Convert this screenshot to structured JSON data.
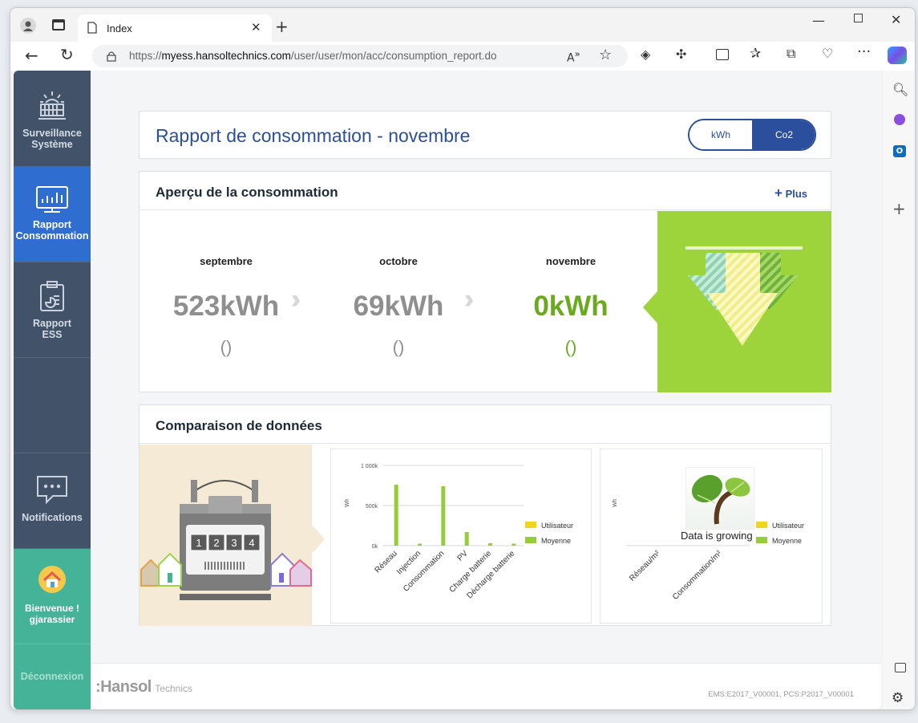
{
  "browser": {
    "tab_title": "Index",
    "url_prefix": "https://",
    "url_domain": "myess.hansoltechnics.com",
    "url_path": "/user/user/mon/acc/consumption_report.do"
  },
  "sidebar": {
    "items": [
      {
        "label1": "Surveillance",
        "label2": "Système"
      },
      {
        "label1": "Rapport",
        "label2": "Consommation"
      },
      {
        "label1": "Rapport",
        "label2": "ESS"
      },
      {
        "label1": "Notifications"
      },
      {
        "label1": "Bienvenue !",
        "label2": "gjarassier"
      },
      {
        "label1": "Déconnexion"
      }
    ]
  },
  "header": {
    "title": "Rapport de consommation - novembre",
    "toggle": {
      "left": "kWh",
      "right": "Co2",
      "selected": "Co2"
    }
  },
  "overview": {
    "title": "Aperçu de la consommation",
    "plus_label": "Plus",
    "months": [
      {
        "name": "septembre",
        "value": "523kWh",
        "sub": "()"
      },
      {
        "name": "octobre",
        "value": "69kWh",
        "sub": "()"
      },
      {
        "name": "novembre",
        "value": "0kWh",
        "sub": "()"
      }
    ]
  },
  "comparison": {
    "title": "Comparaison de données",
    "meter_digits": [
      "1",
      "2",
      "3",
      "4"
    ],
    "chart2_overlay": "Data is growing"
  },
  "chart_data": [
    {
      "type": "bar",
      "ylabel": "Wh",
      "yticks": [
        "1 000k",
        "500k",
        "0k"
      ],
      "ylim": [
        0,
        1000000
      ],
      "categories": [
        "Réseau",
        "Injection",
        "Consommation",
        "PV",
        "Charge batterie",
        "Décharge batterie"
      ],
      "series": [
        {
          "name": "Utilisateur",
          "color": "#f3d416",
          "values": [
            0,
            0,
            0,
            0,
            0,
            0
          ]
        },
        {
          "name": "Moyenne",
          "color": "#94cc3a",
          "values": [
            760000,
            25000,
            740000,
            170000,
            30000,
            25000
          ]
        }
      ],
      "legend": "right"
    },
    {
      "type": "bar",
      "ylabel": "Wh",
      "categories": [
        "Réseau/m²",
        "Consommation/m²"
      ],
      "series": [
        {
          "name": "Utilisateur",
          "color": "#f3d416",
          "values": []
        },
        {
          "name": "Moyenne",
          "color": "#94cc3a",
          "values": []
        }
      ],
      "legend": "right"
    }
  ],
  "footer": {
    "brand": ":Hansol",
    "brand_sub": "Technics",
    "version": "EMS:E2017_V00001, PCS:P2017_V00001"
  },
  "colors": {
    "sidebar": "#425369",
    "active": "#2f6ed0",
    "accent_green": "#6aaa1e",
    "title_blue": "#2b4f9c",
    "welcome": "#45b398"
  }
}
